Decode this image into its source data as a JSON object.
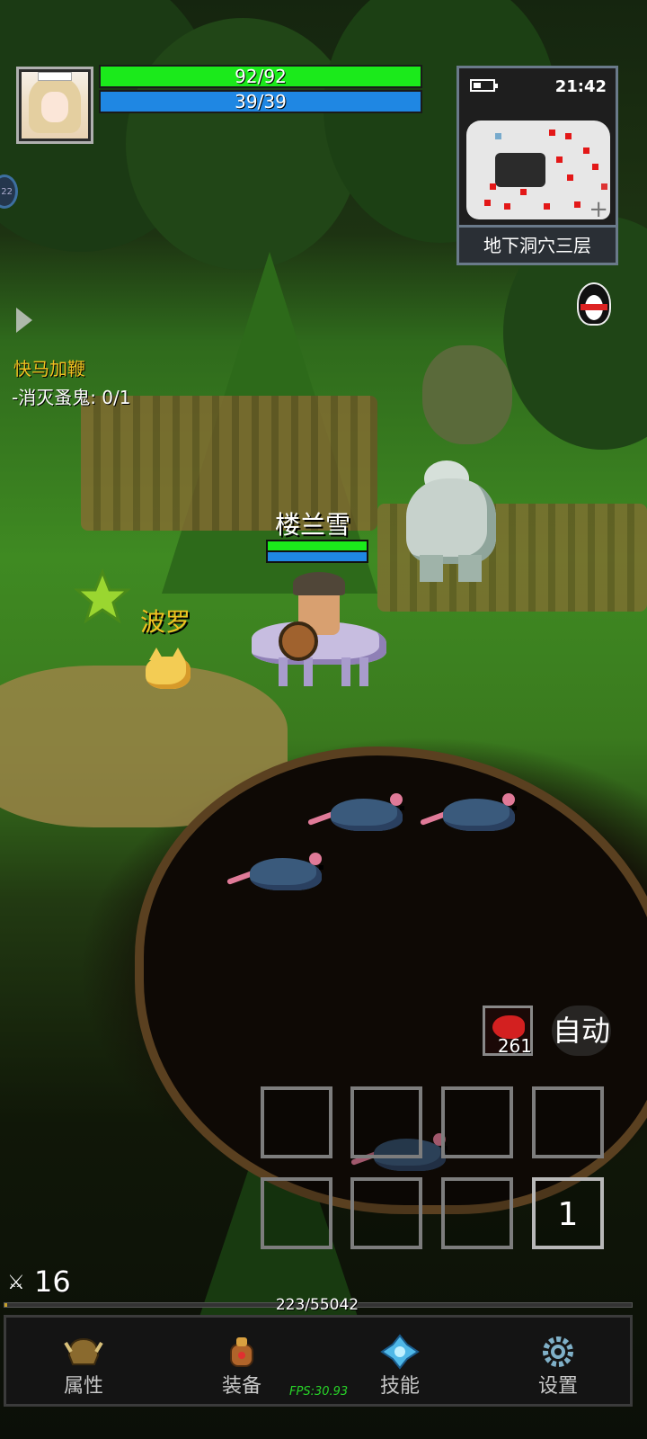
{
  "player": {
    "hp_text": "92/92",
    "hp_fraction": 1.0,
    "mp_text": "39/39",
    "mp_fraction": 1.0,
    "name": "楼兰雪",
    "attack_value": "16"
  },
  "pet": {
    "name": "波罗"
  },
  "minimap": {
    "clock": "21:42",
    "floor_name": "地下洞穴三层",
    "expand_glyph": "+"
  },
  "quest": {
    "title": "快马加鞭",
    "objective": "-消灭蚤鬼: 0/1"
  },
  "side_tag": "22",
  "potion": {
    "count": "261"
  },
  "auto_label": "自动",
  "skill_slots": [
    "",
    "",
    "",
    "",
    "",
    "",
    "",
    "1"
  ],
  "experience": {
    "text": "223/55042",
    "fraction": 0.004
  },
  "nav": {
    "attributes": "属性",
    "equipment": "装备",
    "skills": "技能",
    "settings": "设置"
  },
  "fps_text": "FPS:30.93",
  "colors": {
    "hp": "#1bea1b",
    "mp": "#1f87e3",
    "quest_title": "#f0c020",
    "fps": "#28d428"
  }
}
